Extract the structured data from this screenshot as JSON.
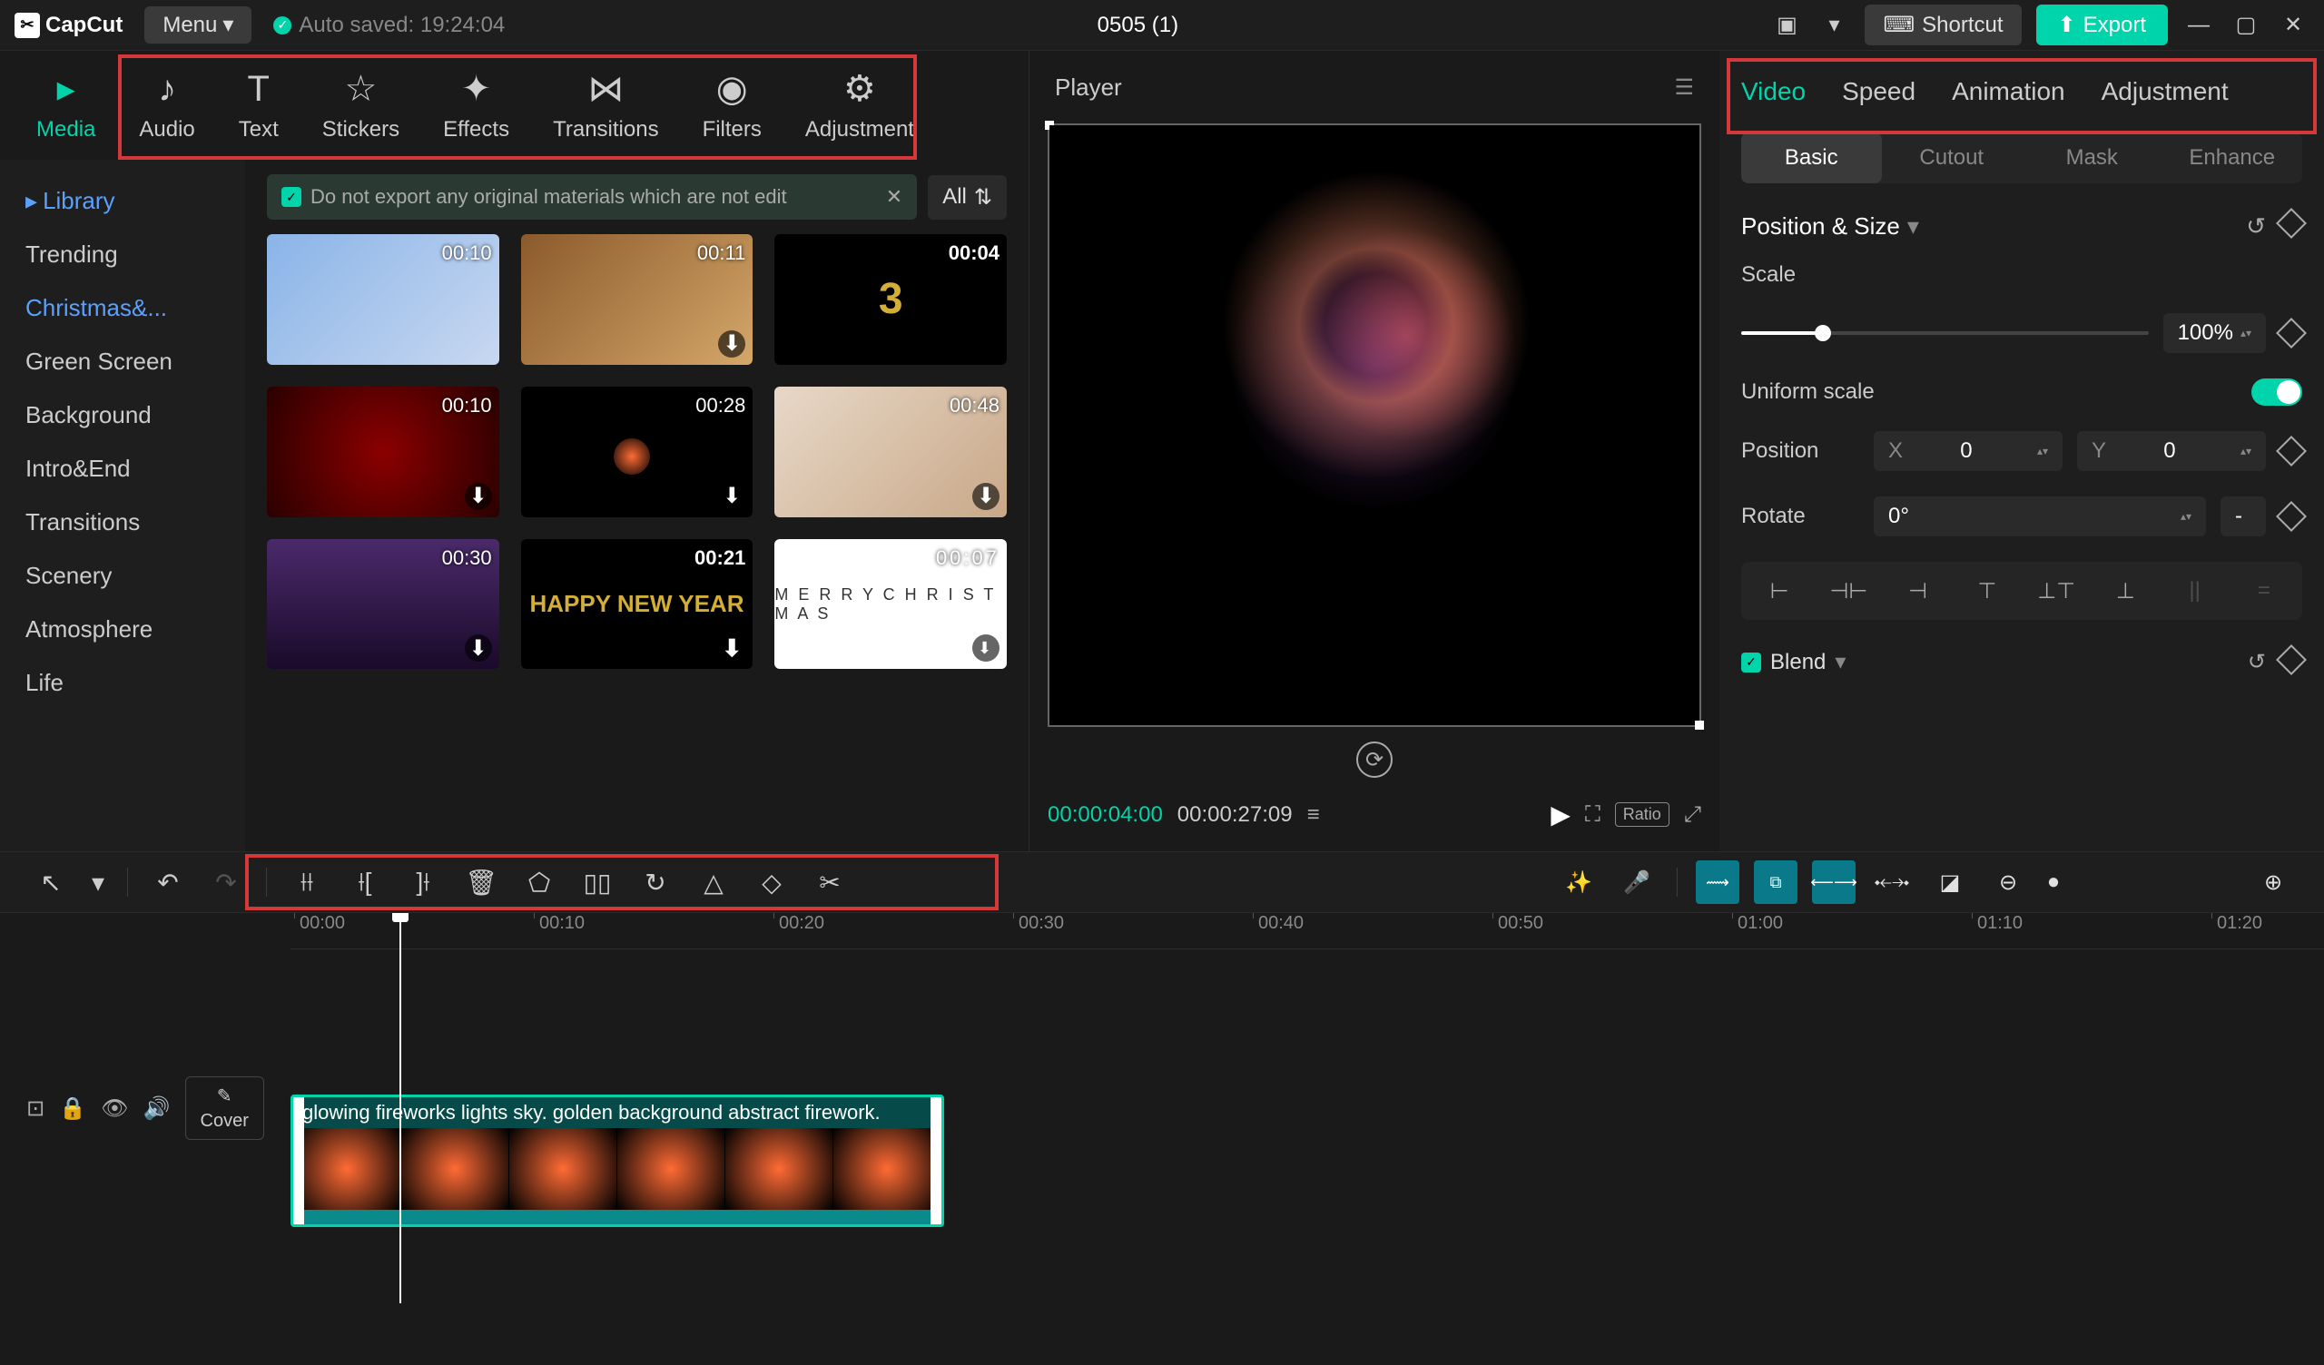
{
  "app": {
    "name": "CapCut",
    "menu_label": "Menu",
    "autosave_text": "Auto saved: 19:24:04",
    "project_title": "0505 (1)",
    "shortcut_label": "Shortcut",
    "export_label": "Export"
  },
  "top_tabs": [
    {
      "id": "media",
      "label": "Media",
      "active": true
    },
    {
      "id": "audio",
      "label": "Audio"
    },
    {
      "id": "text",
      "label": "Text"
    },
    {
      "id": "stickers",
      "label": "Stickers"
    },
    {
      "id": "effects",
      "label": "Effects"
    },
    {
      "id": "transitions",
      "label": "Transitions"
    },
    {
      "id": "filters",
      "label": "Filters"
    },
    {
      "id": "adjustment",
      "label": "Adjustment"
    }
  ],
  "sidebar": {
    "library_label": "Library",
    "items": [
      {
        "label": "Trending"
      },
      {
        "label": "Christmas&...",
        "active": true
      },
      {
        "label": "Green Screen"
      },
      {
        "label": "Background"
      },
      {
        "label": "Intro&End"
      },
      {
        "label": "Transitions"
      },
      {
        "label": "Scenery"
      },
      {
        "label": "Atmosphere"
      },
      {
        "label": "Life"
      }
    ]
  },
  "warning": {
    "text": "Do not export any original materials which are not edit",
    "filter_label": "All"
  },
  "media": [
    {
      "duration": "00:10",
      "type": "snow"
    },
    {
      "duration": "00:11",
      "type": "gifts"
    },
    {
      "duration": "00:04",
      "type": "countdown",
      "text": "3"
    },
    {
      "duration": "00:10",
      "type": "ornament"
    },
    {
      "duration": "00:28",
      "type": "firework"
    },
    {
      "duration": "00:48",
      "type": "family"
    },
    {
      "duration": "00:30",
      "type": "purple"
    },
    {
      "duration": "00:21",
      "type": "newyear",
      "text": "HAPPY NEW YEAR"
    },
    {
      "duration": "00:07",
      "type": "merry",
      "text": "M E R R Y  C H R I S T M A S"
    }
  ],
  "player": {
    "title": "Player",
    "current_time": "00:00:04:00",
    "total_time": "00:00:27:09",
    "ratio_label": "Ratio"
  },
  "right_tabs": [
    {
      "label": "Video",
      "active": true
    },
    {
      "label": "Speed"
    },
    {
      "label": "Animation"
    },
    {
      "label": "Adjustment"
    }
  ],
  "sub_tabs": [
    {
      "label": "Basic",
      "active": true
    },
    {
      "label": "Cutout"
    },
    {
      "label": "Mask"
    },
    {
      "label": "Enhance"
    }
  ],
  "properties": {
    "section_title": "Position & Size",
    "scale_label": "Scale",
    "scale_value": "100%",
    "uniform_label": "Uniform scale",
    "position_label": "Position",
    "x_label": "X",
    "x_value": "0",
    "y_label": "Y",
    "y_value": "0",
    "rotate_label": "Rotate",
    "rotate_value": "0°",
    "rotate_extra": "-",
    "blend_label": "Blend"
  },
  "timeline": {
    "cover_label": "Cover",
    "ruler": [
      "00:00",
      "00:10",
      "00:20",
      "00:30",
      "00:40",
      "00:50",
      "01:00",
      "01:10",
      "01:20"
    ],
    "clip_label": "glowing fireworks lights sky. golden background abstract firework."
  }
}
